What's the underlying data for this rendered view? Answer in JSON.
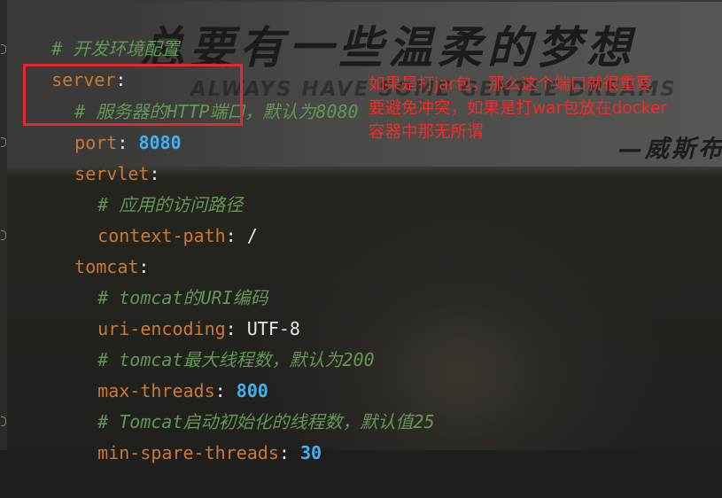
{
  "banner": {
    "title": "总要有一些温柔的梦想",
    "subtitle": "ALWAYS HAVE SOME GENTLE DREAMS",
    "author": "—威斯布"
  },
  "code_lines": [
    {
      "comment": "# 开发环境配置"
    },
    {
      "key": "server",
      "sep": ":"
    },
    {
      "comment": "# 服务器的HTTP端口，默认为8080"
    },
    {
      "key": "port",
      "sep": ": ",
      "value": "8080"
    },
    {
      "key": "servlet",
      "sep": ":"
    },
    {
      "comment": "# 应用的访问路径"
    },
    {
      "key": "context-path",
      "sep": ": ",
      "value": "/"
    },
    {
      "key": "tomcat",
      "sep": ":"
    },
    {
      "comment": "# tomcat的URI编码"
    },
    {
      "key": "uri-encoding",
      "sep": ": ",
      "value": "UTF-8"
    },
    {
      "comment": "# tomcat最大线程数，默认为200"
    },
    {
      "key": "max-threads",
      "sep": ": ",
      "value": "800"
    },
    {
      "comment": "# Tomcat启动初始化的线程数，默认值25"
    },
    {
      "key": "min-spare-threads",
      "sep": ": ",
      "value": "30"
    }
  ],
  "annotation": {
    "lines": [
      "如果是打jar包，那么这个端口就很重要",
      "要避免冲突，如果是打war包放在docker",
      "容器中那无所谓"
    ],
    "color": "#f02b2b"
  },
  "colors": {
    "comment": "#629755",
    "key": "#cc7832",
    "number": "#43b0f0",
    "text": "#e6e6e6",
    "highlight": "#e8262d"
  }
}
